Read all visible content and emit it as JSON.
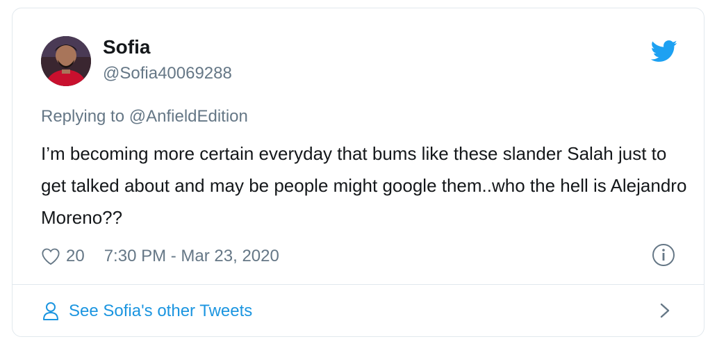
{
  "tweet": {
    "author_name": "Sofia",
    "author_handle": "@Sofia40069288",
    "replying_prefix": "Replying to ",
    "replying_to": "@AnfieldEdition",
    "text": "I’m becoming more certain everyday that bums like these slander Salah just to get talked about and may be people might google them..who the hell is Alejandro Moreno??",
    "likes": "20",
    "timestamp": "7:30 PM - Mar 23, 2020"
  },
  "footer": {
    "see_other_tweets": "See Sofia's other Tweets"
  },
  "icons": {
    "bird": "twitter-bird-icon",
    "heart": "heart-icon",
    "info": "info-icon",
    "person": "person-icon",
    "chevron": "chevron-right-icon"
  },
  "colors": {
    "twitter_blue": "#1da1f2",
    "link_blue": "#1b95e0",
    "secondary_text": "#657786",
    "primary_text": "#14171a",
    "border": "#e1e8ed"
  }
}
